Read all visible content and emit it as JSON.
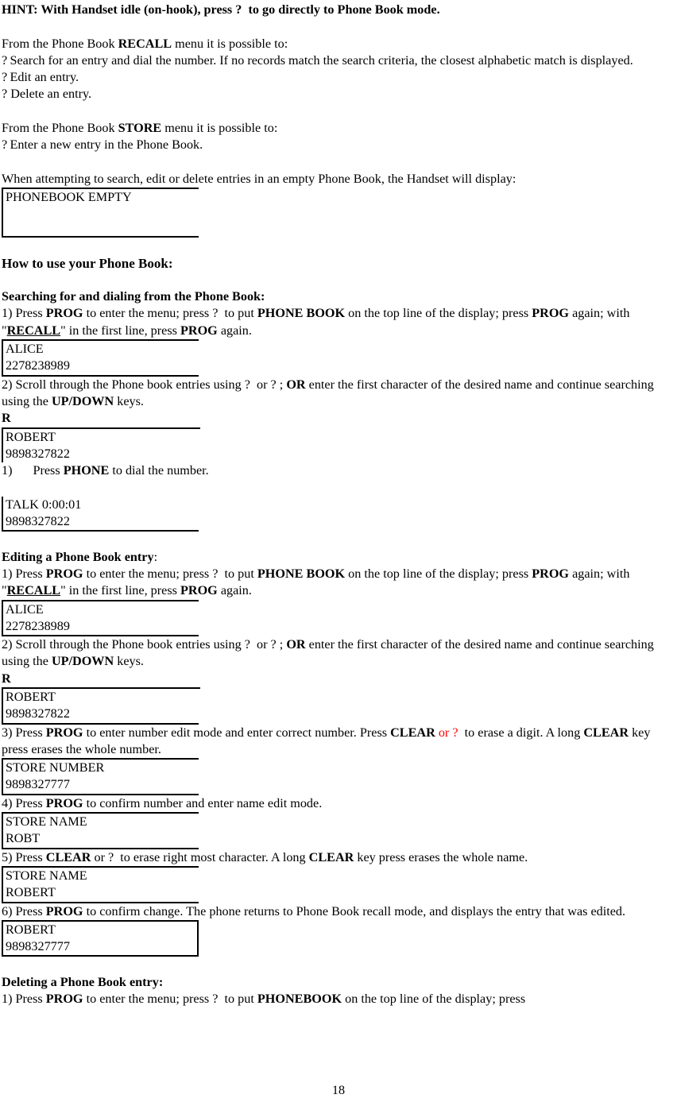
{
  "document": {
    "page_number": "18",
    "glyph": "?",
    "hint": {
      "prefix": "HINT: With Handset idle (on-hook), press ",
      "glyph": "?",
      "suffix": " to go directly to Phone Book mode."
    },
    "recall_intro": {
      "lead": "From the Phone Book ",
      "keyword": "RECALL",
      "tail": " menu it is possible to:"
    },
    "recall_bullets": [
      "Search for an entry and dial the number. If no records match the search criteria, the closest alphabetic match is displayed.",
      "Edit an entry.",
      "Delete an entry."
    ],
    "store_intro": {
      "lead": "From the Phone Book ",
      "keyword": "STORE",
      "tail": " menu it is possible to:"
    },
    "store_bullets": [
      "Enter a new entry in the Phone Book."
    ],
    "empty_note": "When attempting to search, edit or delete entries in an empty Phone Book, the Handset will display:",
    "empty_display": {
      "line1": "PHONEBOOK EMPTY",
      "line2": ""
    },
    "how_to_heading": "How to use your Phone Book:",
    "searching": {
      "heading": "Searching for and dialing from the Phone Book:",
      "step1": {
        "a": "1) Press ",
        "prog1": "PROG",
        "b": " to enter the menu; press ",
        "glyph": "?",
        "c": " to put ",
        "phonebook": "PHONE BOOK",
        "d": " on the top line of the display; press ",
        "prog2": "PROG",
        "e": " again; with \"",
        "recall": "RECALL",
        "f": "\" in the first line, press ",
        "prog3": "PROG",
        "g": " again."
      },
      "display1": {
        "line1": "ALICE",
        "line2": "2278238989"
      },
      "step2": {
        "a": "2) Scroll through the Phone book entries using ",
        "glyph1": "?",
        "b": " or ",
        "glyph2": "?",
        "c": " ; ",
        "or": "OR",
        "d": " enter the first character of the desired name and continue searching using the ",
        "updown": "UP/DOWN",
        "e": " keys."
      },
      "display2_letter": "R",
      "display2": {
        "line1": "ROBERT",
        "line2": "9898327822"
      },
      "step3": {
        "num": "1)",
        "a": "Press ",
        "phone": "PHONE",
        "b": " to dial the number."
      },
      "display3": {
        "line1": "TALK 0:00:01",
        "line2": "9898327822"
      }
    },
    "editing": {
      "heading_main": "Editing a Phone Book entry",
      "heading_colon": ":",
      "step1": {
        "a": "1) Press ",
        "prog1": "PROG",
        "b": " to enter the menu; press ",
        "glyph": "?",
        "c": " to put ",
        "phonebook": "PHONE BOOK",
        "d": " on the top line of the display; press ",
        "prog2": "PROG",
        "e": " again; with \"",
        "recall": "RECALL",
        "f": "\" in the first line, press ",
        "prog3": "PROG",
        "g": " again."
      },
      "display1": {
        "line1": "ALICE",
        "line2": "2278238989"
      },
      "step2": {
        "a": "2) Scroll through the Phone book entries using ",
        "glyph1": "?",
        "b": " or ",
        "glyph2": "?",
        "c": " ; ",
        "or": "OR",
        "d": " enter the first character of the desired name and continue searching using the ",
        "updown": "UP/DOWN",
        "e": " keys."
      },
      "display2_letter": "R",
      "display2": {
        "line1": "ROBERT",
        "line2": "9898327822"
      },
      "step3": {
        "a": "3) Press ",
        "prog": "PROG",
        "b": " to enter number edit mode and enter correct number. Press ",
        "clear1": "CLEAR",
        "c_red": " or ?",
        "d": " to erase a digit. A long ",
        "clear2": "CLEAR",
        "e": " key press erases the whole number."
      },
      "display3": {
        "line1": "STORE NUMBER",
        "line2": "9898327777"
      },
      "step4": {
        "a": "4) Press ",
        "prog": "PROG",
        "b": " to confirm number and enter name edit mode."
      },
      "display4": {
        "line1": "STORE NAME",
        "line2": "ROBT"
      },
      "step5": {
        "a": "5) Press ",
        "clear1": "CLEAR",
        "b": " or ",
        "glyph": "?",
        "c": " to erase right most character. A long ",
        "clear2": "CLEAR",
        "d": " key press erases the whole name."
      },
      "display5": {
        "line1": "STORE NAME",
        "line2": "ROBERT"
      },
      "step6": {
        "a": "6) Press ",
        "prog": "PROG",
        "b": " to confirm change. The phone returns to Phone Book recall mode, and displays the entry that was edited."
      },
      "display6": {
        "line1": "ROBERT",
        "line2": "9898327777"
      }
    },
    "deleting": {
      "heading": "Deleting a Phone Book entry:",
      "step1": {
        "a": "1) Press ",
        "prog1": "PROG",
        "b": " to enter the menu; press ",
        "glyph": "?",
        "c": " to put ",
        "phonebook": "PHONEBOOK",
        "d": " on the top line of the display; press"
      }
    }
  },
  "colors": {
    "text": "#000000",
    "accent_red": "#ff0000",
    "border": "#000000",
    "background": "#ffffff"
  }
}
